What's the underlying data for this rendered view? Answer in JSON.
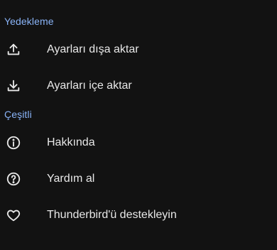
{
  "backup": {
    "header": "Yedekleme",
    "items": [
      {
        "label": "Ayarları dışa aktar",
        "icon": "upload-icon"
      },
      {
        "label": "Ayarları içe aktar",
        "icon": "download-icon"
      }
    ]
  },
  "misc": {
    "header": "Çeşitli",
    "items": [
      {
        "label": "Hakkında",
        "icon": "info-icon"
      },
      {
        "label": "Yardım al",
        "icon": "help-icon"
      },
      {
        "label": "Thunderbird'ü destekleyin",
        "icon": "heart-icon"
      }
    ]
  },
  "colors": {
    "background": "#121212",
    "section_header": "#8ab4f8",
    "text": "#e8e8e8"
  }
}
